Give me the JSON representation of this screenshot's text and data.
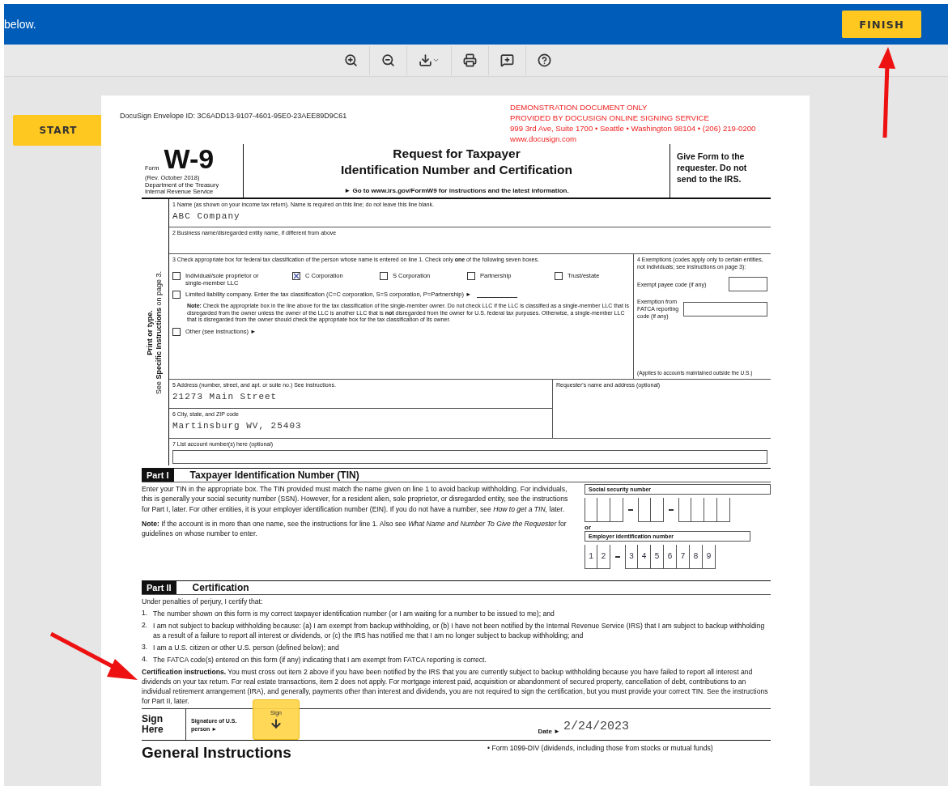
{
  "banner": {
    "text": "below.",
    "finish_button": "FINISH"
  },
  "start_button": "START",
  "document": {
    "envelope_id": "DocuSign Envelope ID: 3C6ADD13-9107-4601-95E0-23AEE89D9C61",
    "demo_notice": [
      "DEMONSTRATION DOCUMENT ONLY",
      "PROVIDED BY DOCUSIGN ONLINE SIGNING SERVICE",
      "999 3rd Ave, Suite 1700  • Seattle • Washington 98104 • (206) 219-0200",
      "www.docusign.com"
    ],
    "header": {
      "form_label": "Form",
      "form_number": "W-9",
      "revision": "(Rev. October 2018)",
      "department": [
        "Department of the Treasury",
        "Internal Revenue Service"
      ],
      "title": [
        "Request for Taxpayer",
        "Identification Number and Certification"
      ],
      "instruction": "► Go to www.irs.gov/FormW9 for instructions and the latest information.",
      "give_form": "Give Form to the requester. Do not send to the IRS."
    },
    "side_label": [
      "Print or type.",
      "See **Specific Instructions** on page 3."
    ],
    "line1": {
      "label": "1 Name (as shown on your income tax return). Name is required on this line; do not leave this line blank.",
      "value": "ABC Company"
    },
    "line2": {
      "label": "2 Business name/disregarded entity name, if different from above"
    },
    "line3": {
      "label": "3 Check appropriate box for federal tax classification of the person whose name is entered on line 1. Check only **one** of the following seven boxes.",
      "classifications": [
        {
          "label": "Individual/sole proprietor or single-member LLC",
          "checked": false
        },
        {
          "label": "C Corporation",
          "checked": true
        },
        {
          "label": "S Corporation",
          "checked": false
        },
        {
          "label": "Partnership",
          "checked": false
        },
        {
          "label": "Trust/estate",
          "checked": false
        }
      ],
      "llc": {
        "label": "Limited liability company. Enter the tax classification (C=C corporation, S=S corporation, P=Partnership) ►",
        "checked": false
      },
      "note": "**Note:** Check the appropriate box in the line above for the tax classification of the single-member owner.  Do not check LLC if the LLC is classified as a single-member LLC that is disregarded from the owner unless the owner of the LLC is another LLC that is **not** disregarded from the owner for U.S. federal tax purposes. Otherwise, a single-member LLC that is disregarded from the owner should check the appropriate box for the tax classification of its owner.",
      "other": {
        "label": "Other (see instructions) ►",
        "checked": false
      }
    },
    "line4": {
      "label": "4 Exemptions (codes apply only to certain entities, not individuals; see instructions on page 3):",
      "exempt_payee": "Exempt payee code (if any)",
      "fatca": "Exemption from FATCA reporting code (if any)",
      "fatca_note": "(Applies to accounts maintained outside the U.S.)"
    },
    "line5": {
      "label": "5 Address (number, street, and apt. or suite no.) See instructions.",
      "value": "21273 Main Street"
    },
    "line6": {
      "label": "6 City, state, and ZIP code",
      "value": "Martinsburg WV, 25403"
    },
    "requester": {
      "label": "Requester's name and address (optional)"
    },
    "line7": {
      "label": "7 List account number(s) here (optional)"
    },
    "part1": {
      "tag": "Part I",
      "title": "Taxpayer Identification Number (TIN)",
      "text": "Enter your TIN in the appropriate box. The TIN provided must match the name given on line 1 to avoid backup withholding. For individuals, this is generally your social security number (SSN). However, for a resident alien, sole proprietor, or disregarded entity, see the instructions for Part I, later. For other entities, it is your employer identification number (EIN). If you do not have a number, see *How to get a TIN,* later.",
      "note": "**Note:** If the account is in more than one name, see the instructions for line 1. Also see *What Name and Number To Give the Requester* for guidelines on whose number to enter.",
      "ssn_label": "Social security number",
      "or": "or",
      "ein_label": "Employer identification number",
      "ein_groups": [
        [
          "1",
          "2"
        ],
        [
          "3",
          "4",
          "5",
          "6",
          "7",
          "8",
          "9"
        ]
      ]
    },
    "part2": {
      "tag": "Part II",
      "title": "Certification",
      "intro": "Under penalties of perjury, I certify that:",
      "items": [
        {
          "number": "1.",
          "text": "The number shown on this form is my correct taxpayer identification number (or I am waiting for a number to be issued to me); and"
        },
        {
          "number": "2.",
          "text": "I am not subject to backup withholding because: (a) I am exempt from backup withholding, or (b) I have not been notified by the Internal Revenue Service (IRS) that I am subject to backup withholding as a result of a failure to report all interest or dividends, or (c) the IRS has notified me that I am no longer subject to backup withholding; and"
        },
        {
          "number": "3.",
          "text": "I am a U.S. citizen or other U.S. person (defined below); and"
        },
        {
          "number": "4.",
          "text": "The FATCA code(s) entered on this form (if any) indicating that I am exempt from FATCA reporting is correct."
        }
      ],
      "instructions": "**Certification instructions.** You must cross out item 2 above if you have been notified by the IRS that you are currently subject to backup withholding because you have failed to report all interest and dividends on your tax return. For real estate transactions, item 2 does not apply. For mortgage interest paid, acquisition or abandonment of secured property, cancellation of debt, contributions to an individual retirement arrangement (IRA), and generally, payments other than interest and dividends, you are not required to sign the certification, but you must provide your correct TIN. See the instructions for Part II, later."
    },
    "sign": {
      "heading": "Sign Here",
      "signature_label": "Signature of U.S. person ►",
      "sign_tag": "Sign",
      "date_label": "Date ►",
      "date_value": "2/24/2023"
    },
    "general": {
      "heading": "General Instructions",
      "bullet": "• Form 1099-DIV (dividends, including those from stocks or mutual funds)"
    }
  }
}
